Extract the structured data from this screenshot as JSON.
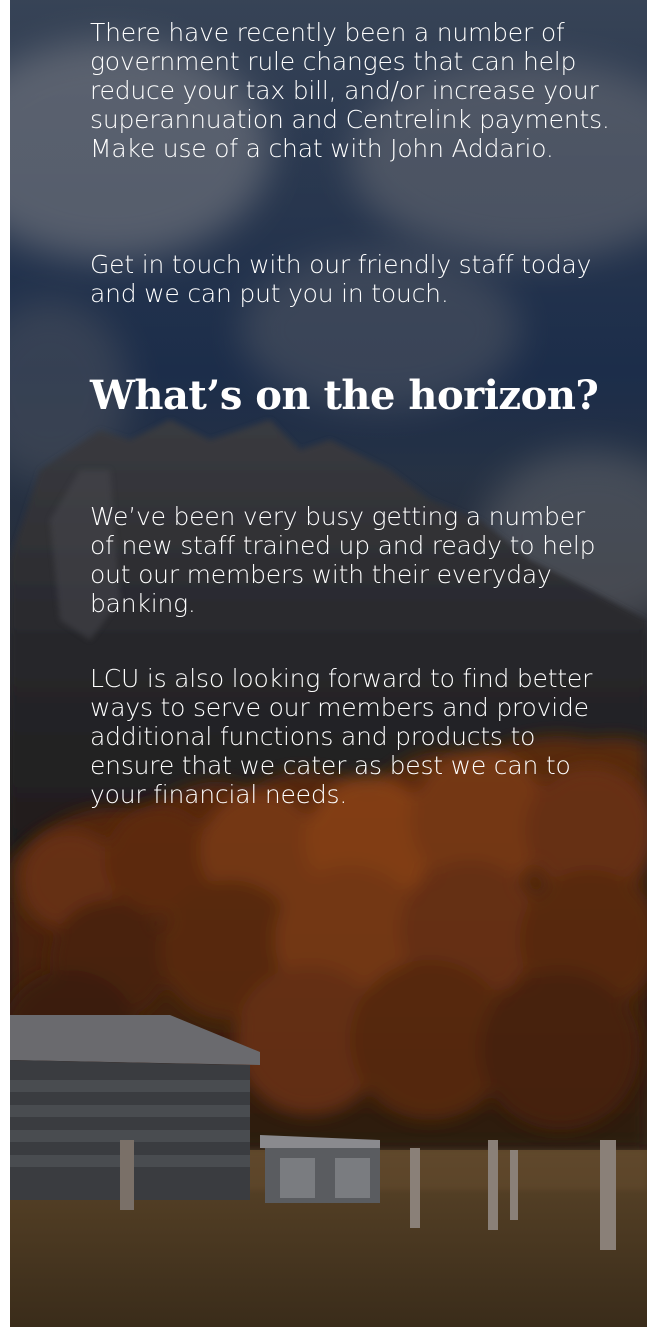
{
  "article": {
    "intro_paragraph": "There have recently been a number of government rule changes that can help reduce your tax bill, and/or increase your superannuation and Centrelink payments. Make use of a chat with John Addario.",
    "contact_paragraph": "Get in touch with our friendly staff today and we can put you in touch.",
    "section_heading": "What’s on the horizon?",
    "staff_paragraph": "We’ve been very busy getting a number of new staff trained up and ready to help out our members with their everyday banking.",
    "future_paragraph": "LCU is also looking forward to find better ways to serve our members and provide additional functions and products to ensure that we cater as best we can to your financial needs."
  },
  "colors": {
    "text": "#ffffff",
    "sky_blue": "#203456",
    "forest_orange": "#8a3a12"
  },
  "background_image": "mountain-forest-farm-shed-landscape"
}
